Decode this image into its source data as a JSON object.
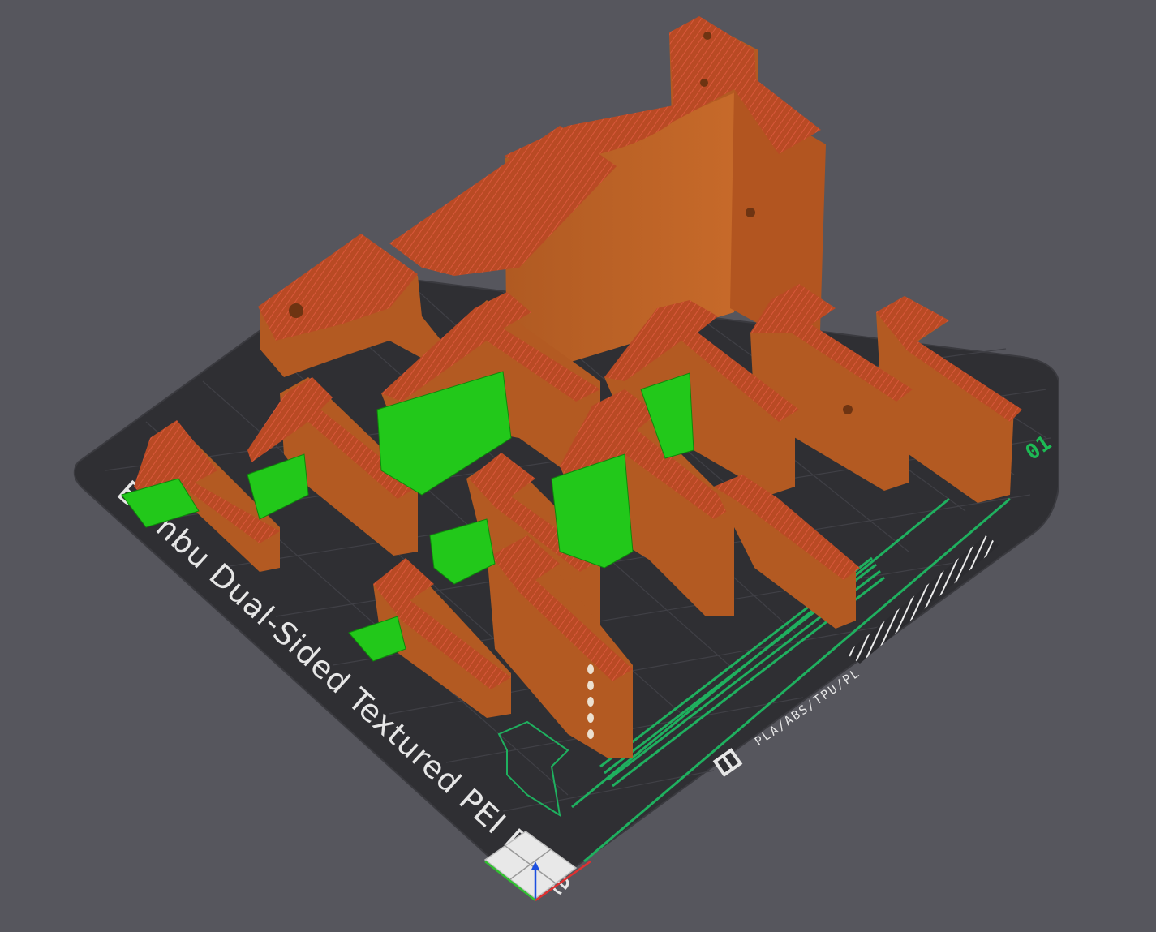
{
  "plate": {
    "label": "Bambu Dual-Sided Textured PEI Plate",
    "material_text": "PLA/ABS/TPU/PL",
    "plate_number": "01"
  },
  "colors": {
    "background": "#56565d",
    "plate": "#2f2f33",
    "grid": "#3e3e44",
    "part_wall": "#b5581c",
    "part_top": "#c23a2a",
    "support": "#22c81a",
    "skirt": "#1fb05f"
  },
  "icons": {
    "view_cube": "view-cube-icon",
    "axis_gizmo": "axis-gizmo-icon",
    "plate_logo": "bambu-logo-icon"
  }
}
